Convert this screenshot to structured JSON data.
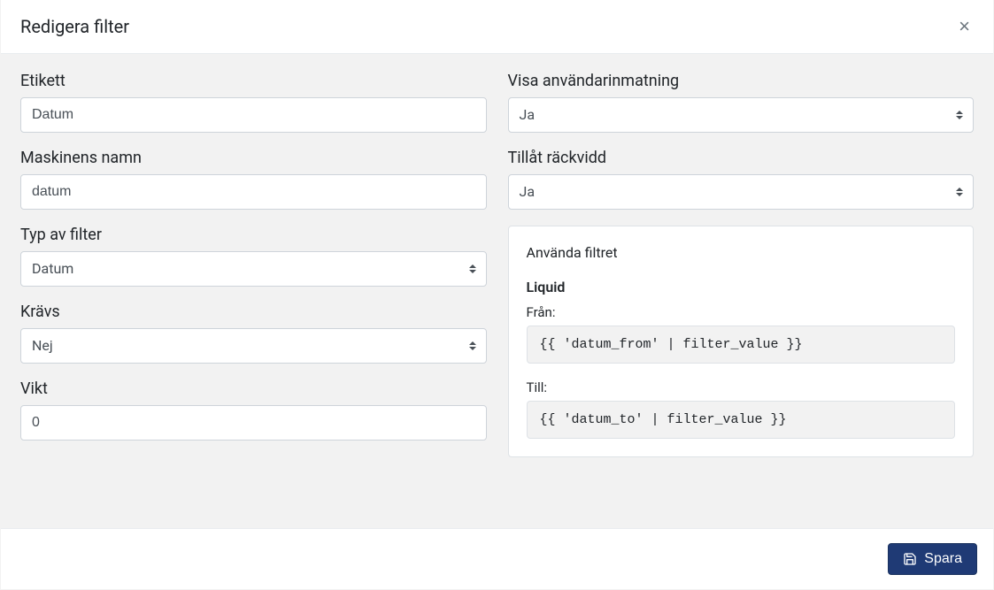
{
  "header": {
    "title": "Redigera filter"
  },
  "left": {
    "etikett": {
      "label": "Etikett",
      "value": "Datum"
    },
    "maskinnamn": {
      "label": "Maskinens namn",
      "value": "datum"
    },
    "typ": {
      "label": "Typ av filter",
      "value": "Datum"
    },
    "kravs": {
      "label": "Krävs",
      "value": "Nej"
    },
    "vikt": {
      "label": "Vikt",
      "value": "0"
    }
  },
  "right": {
    "visa": {
      "label": "Visa användarinmatning",
      "value": "Ja"
    },
    "rackvidd": {
      "label": "Tillåt räckvidd",
      "value": "Ja"
    }
  },
  "usage": {
    "title": "Använda filtret",
    "liquid_heading": "Liquid",
    "from_label": "Från:",
    "from_code": "{{ 'datum_from' | filter_value }}",
    "to_label": "Till:",
    "to_code": "{{ 'datum_to' | filter_value }}"
  },
  "footer": {
    "save_label": "Spara"
  }
}
